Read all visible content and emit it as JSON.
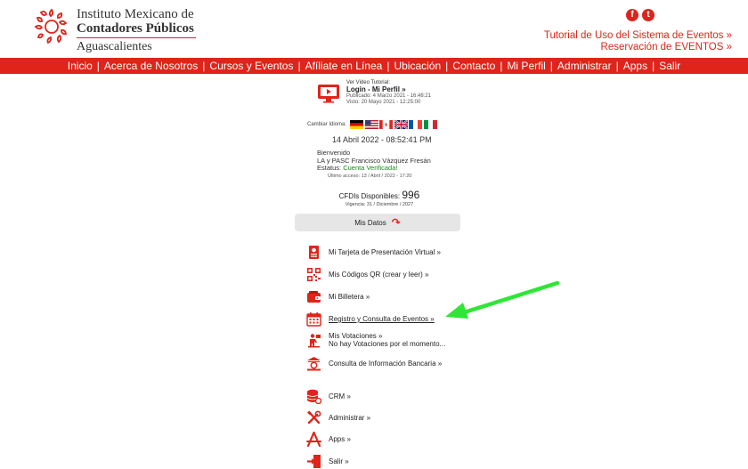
{
  "header": {
    "org_line1": "Instituto Mexicano de",
    "org_line2": "Contadores Públicos",
    "org_line3": "Aguascalientes",
    "tutorial_link": "Tutorial de Uso del Sistema de Eventos »",
    "reservation_link": "Reservación de EVENTOS »",
    "social": {
      "facebook": "f",
      "twitter": "t"
    },
    "logo_icon": "imcp-logo-icon"
  },
  "nav": {
    "items": [
      "Inicio",
      "Acerca de Nosotros",
      "Cursos y Eventos",
      "Afíliate en Línea",
      "Ubicación",
      "Contacto",
      "Mi Perfil",
      "Administrar",
      "Apps",
      "Salir"
    ],
    "separator": "|"
  },
  "video": {
    "caption": "Ver Video Tutorial:",
    "title": "Login - Mi Perfil »",
    "published": "Publicado: 4 Marzo 2021 - 16:48:21",
    "viewed": "Visto: 20 Mayo 2021 - 12:25:00",
    "icon": "monitor-play-icon"
  },
  "language": {
    "label": "Cambiar Idioma:",
    "flags": [
      "germany-flag",
      "usa-flag",
      "canada-flag",
      "uk-flag",
      "france-flag",
      "italy-flag"
    ]
  },
  "datetime": "14 Abril 2022 - 08:52:41 PM",
  "welcome": {
    "greeting": "Bienvenido",
    "name": "LA y PASC Francisco Vázquez Fresán",
    "status_label": "Estatus: ",
    "status_value": "Cuenta Verificada!",
    "last_access": "Último acceso: 13 / Abril / 2022 - 17:20"
  },
  "cfdi": {
    "label": "CFDIs Disponibles: ",
    "count": "996",
    "validity": "Vigencia: 31 / Diciembre / 2027"
  },
  "mis_datos": {
    "label": "Mis Datos",
    "arrow_icon": "curved-arrow-icon"
  },
  "menu": {
    "items": [
      {
        "label": "Mi Tarjeta de Presentación Virtual »",
        "icon": "business-card-icon"
      },
      {
        "label": "Mis Códigos QR (crear y leer) »",
        "icon": "qr-code-icon"
      },
      {
        "label": "Mi Billetera »",
        "icon": "wallet-icon"
      },
      {
        "label": "Registro y Consulta de Eventos »",
        "icon": "calendar-icon"
      },
      {
        "label": "Mis Votaciones »",
        "sublabel": "No hay Votaciones por el momento...",
        "icon": "vote-icon"
      },
      {
        "label": "Consulta de Información Bancaria »",
        "icon": "bank-icon"
      },
      {
        "label": "CRM »",
        "icon": "database-icon"
      },
      {
        "label": "Administrar »",
        "icon": "tools-icon"
      },
      {
        "label": "Apps »",
        "icon": "apps-icon"
      },
      {
        "label": "Salir »",
        "icon": "exit-icon"
      }
    ]
  },
  "annotation": {
    "icon": "green-pointer-arrow"
  },
  "colors": {
    "brand_red": "#e0241a",
    "verified_green": "#1a8a1a",
    "annotation_green": "#2ee636"
  }
}
